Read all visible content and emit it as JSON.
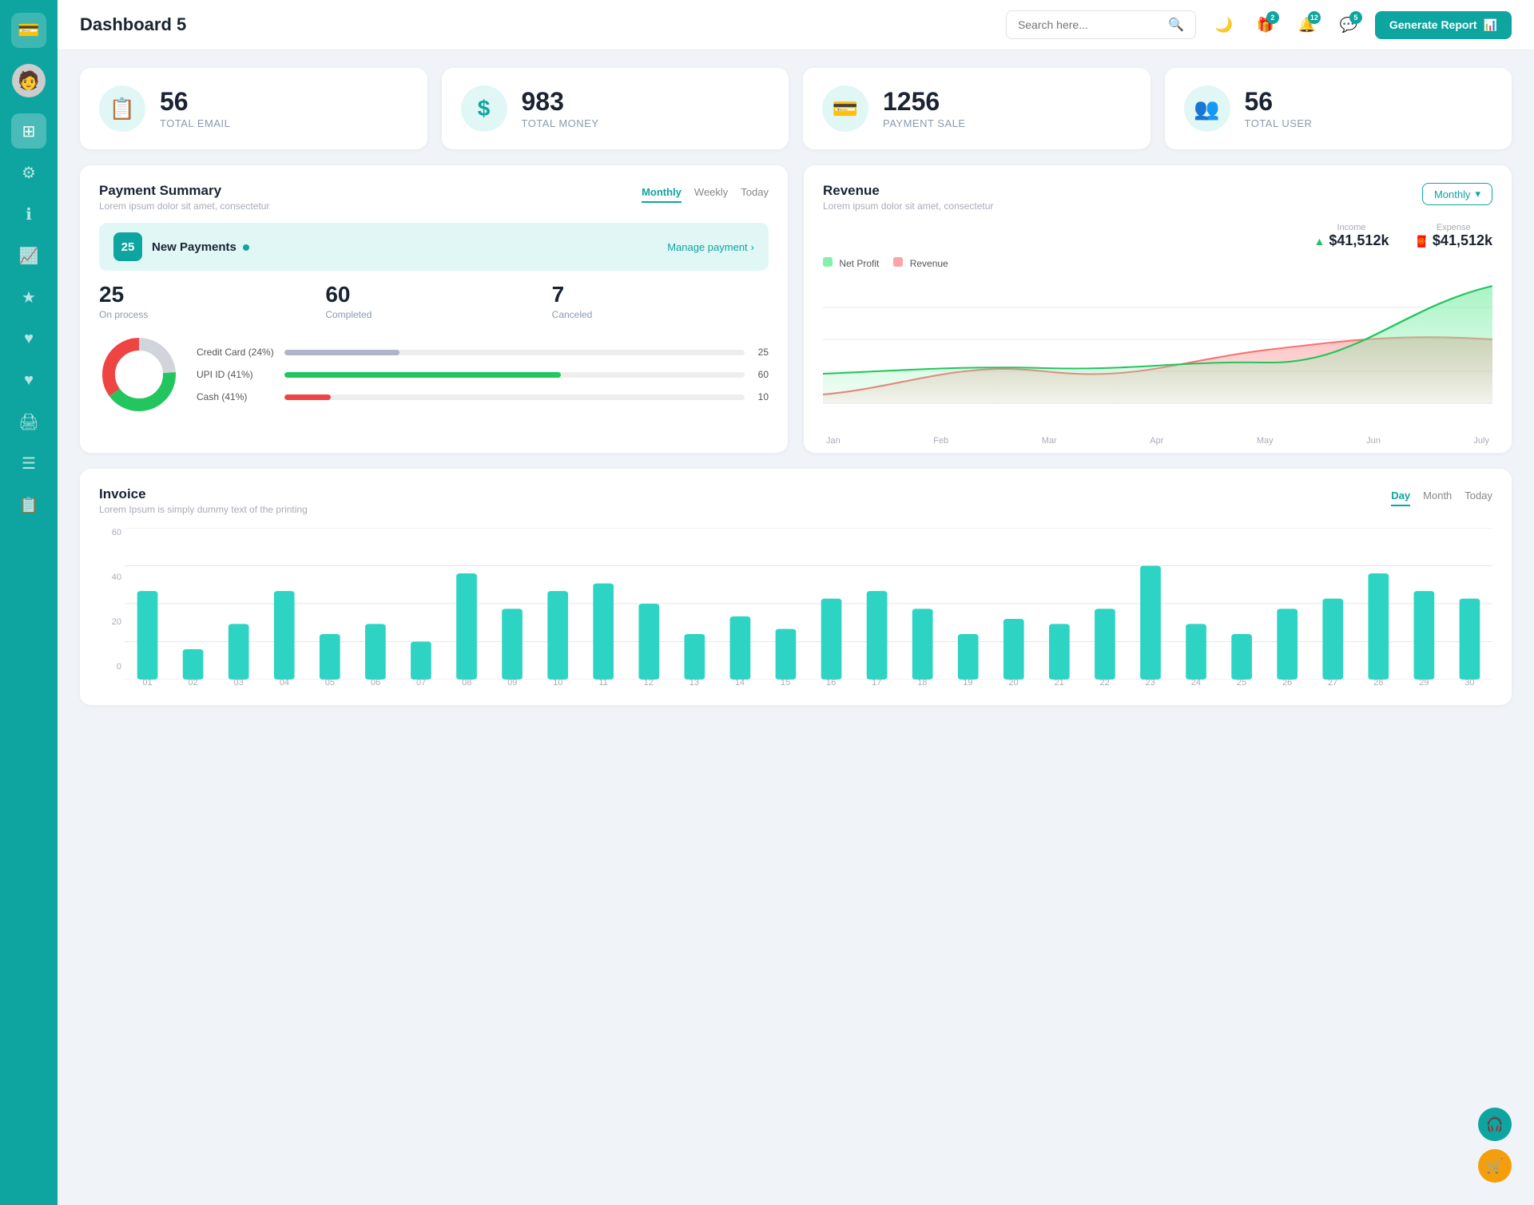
{
  "app": {
    "title": "Dashboard 5"
  },
  "sidebar": {
    "items": [
      {
        "id": "wallet",
        "icon": "💳",
        "active": false
      },
      {
        "id": "dashboard",
        "icon": "⊞",
        "active": true
      },
      {
        "id": "settings",
        "icon": "⚙",
        "active": false
      },
      {
        "id": "info",
        "icon": "ℹ",
        "active": false
      },
      {
        "id": "chart",
        "icon": "📊",
        "active": false
      },
      {
        "id": "star",
        "icon": "★",
        "active": false
      },
      {
        "id": "heart",
        "icon": "♥",
        "active": false
      },
      {
        "id": "heart2",
        "icon": "♥",
        "active": false
      },
      {
        "id": "print",
        "icon": "🖨",
        "active": false
      },
      {
        "id": "list",
        "icon": "☰",
        "active": false
      },
      {
        "id": "doc",
        "icon": "📋",
        "active": false
      }
    ]
  },
  "topbar": {
    "title": "Dashboard 5",
    "search_placeholder": "Search here...",
    "generate_btn": "Generate Report",
    "badges": {
      "gift": "2",
      "bell": "12",
      "chat": "5"
    }
  },
  "stats": [
    {
      "id": "email",
      "number": "56",
      "label": "TOTAL EMAIL",
      "icon": "📋"
    },
    {
      "id": "money",
      "number": "983",
      "label": "TOTAL MONEY",
      "icon": "$"
    },
    {
      "id": "payment",
      "number": "1256",
      "label": "PAYMENT SALE",
      "icon": "💳"
    },
    {
      "id": "user",
      "number": "56",
      "label": "TOTAL USER",
      "icon": "👥"
    }
  ],
  "payment_summary": {
    "title": "Payment Summary",
    "subtitle": "Lorem ipsum dolor sit amet, consectetur",
    "tabs": [
      "Monthly",
      "Weekly",
      "Today"
    ],
    "active_tab": "Monthly",
    "new_payments_count": "25",
    "new_payments_label": "New Payments",
    "manage_link": "Manage payment",
    "stats": [
      {
        "number": "25",
        "label": "On process"
      },
      {
        "number": "60",
        "label": "Completed"
      },
      {
        "number": "7",
        "label": "Canceled"
      }
    ],
    "progress_items": [
      {
        "label": "Credit Card (24%)",
        "value": 25,
        "max": 100,
        "color": "#adb5c8",
        "display": "25"
      },
      {
        "label": "UPI ID (41%)",
        "value": 60,
        "max": 100,
        "color": "#22c55e",
        "display": "60"
      },
      {
        "label": "Cash (41%)",
        "value": 10,
        "max": 100,
        "color": "#ef4444",
        "display": "10"
      }
    ],
    "donut": {
      "segments": [
        {
          "color": "#d1d5db",
          "pct": 24
        },
        {
          "color": "#22c55e",
          "pct": 41
        },
        {
          "color": "#ef4444",
          "pct": 35
        }
      ]
    }
  },
  "revenue": {
    "title": "Revenue",
    "subtitle": "Lorem ipsum dolor sit amet, consectetur",
    "active_tab": "Monthly",
    "income": "$41,512k",
    "expense": "$41,512k",
    "income_label": "Income",
    "expense_label": "Expense",
    "legend": [
      {
        "label": "Net Profit",
        "color": "#86efac"
      },
      {
        "label": "Revenue",
        "color": "#fca5a5"
      }
    ],
    "x_labels": [
      "Jan",
      "Feb",
      "Mar",
      "Apr",
      "May",
      "Jun",
      "July"
    ],
    "y_labels": [
      "0",
      "30",
      "60",
      "90",
      "120"
    ],
    "net_profit_data": [
      28,
      30,
      35,
      28,
      38,
      45,
      95
    ],
    "revenue_data": [
      8,
      25,
      38,
      30,
      40,
      50,
      55
    ]
  },
  "invoice": {
    "title": "Invoice",
    "subtitle": "Lorem Ipsum is simply dummy text of the printing",
    "tabs": [
      "Day",
      "Month",
      "Today"
    ],
    "active_tab": "Day",
    "y_labels": [
      "0",
      "20",
      "40",
      "60"
    ],
    "x_labels": [
      "01",
      "02",
      "03",
      "04",
      "05",
      "06",
      "07",
      "08",
      "09",
      "10",
      "11",
      "12",
      "13",
      "14",
      "15",
      "16",
      "17",
      "18",
      "19",
      "20",
      "21",
      "22",
      "23",
      "24",
      "25",
      "26",
      "27",
      "28",
      "29",
      "30"
    ],
    "bar_data": [
      35,
      12,
      22,
      35,
      18,
      22,
      15,
      42,
      28,
      35,
      38,
      30,
      18,
      25,
      20,
      32,
      35,
      28,
      18,
      24,
      22,
      28,
      45,
      22,
      18,
      28,
      32,
      42,
      35,
      32
    ]
  },
  "float_btns": [
    {
      "id": "headset",
      "icon": "🎧",
      "color": "teal"
    },
    {
      "id": "cart",
      "icon": "🛒",
      "color": "yellow"
    }
  ]
}
